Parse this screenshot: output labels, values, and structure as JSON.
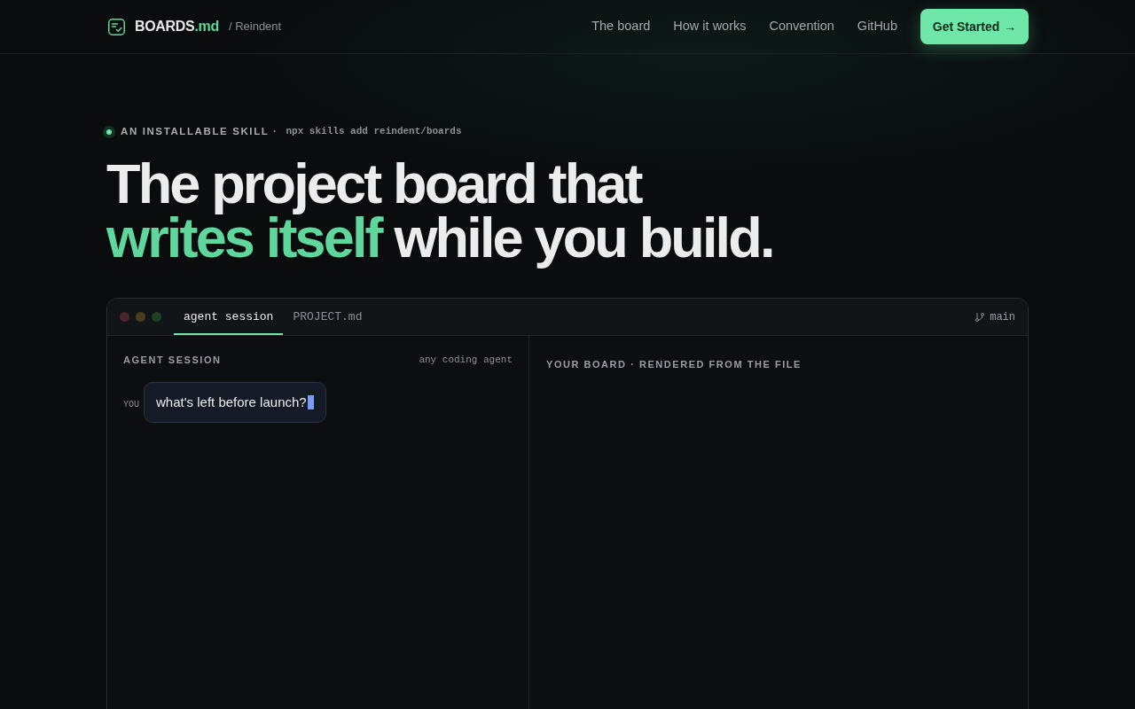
{
  "header": {
    "logo": {
      "name": "BOARDS",
      "suffix": ".md",
      "org": "/ Reindent"
    },
    "nav": [
      {
        "label": "The board"
      },
      {
        "label": "How it works"
      },
      {
        "label": "Convention"
      },
      {
        "label": "GitHub"
      }
    ],
    "cta": {
      "label": "Get Started",
      "arrow": "→"
    }
  },
  "hero": {
    "badge": {
      "label": "AN INSTALLABLE SKILL ·",
      "command": "npx skills add reindent/boards"
    },
    "headline": {
      "line_1": "The project board that",
      "highlight": "writes itself",
      "rest": "while you build."
    }
  },
  "window": {
    "tabs": [
      {
        "label": "agent session",
        "selected": true
      },
      {
        "label": "PROJECT.md",
        "selected": false
      }
    ],
    "branch": "main",
    "session_panel": {
      "title": "AGENT SESSION",
      "note": "any coding agent",
      "messages": [
        {
          "speaker": "YOU",
          "text": "what's left before launch?",
          "cursor": true
        }
      ]
    },
    "board_panel": {
      "title": "YOUR BOARD · RENDERED FROM THE FILE"
    }
  }
}
